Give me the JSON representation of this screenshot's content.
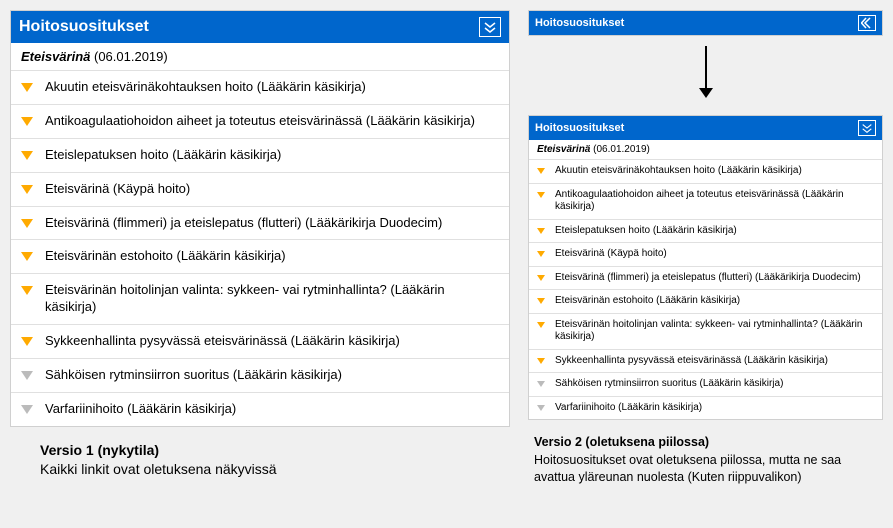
{
  "panel_title": "Hoitosuositukset",
  "topic": "Eteisvärinä",
  "date": "(06.01.2019)",
  "items": [
    {
      "label": "Akuutin eteisvärinäkohtauksen hoito (Lääkärin käsikirja)",
      "active": true
    },
    {
      "label": "Antikoagulaatiohoidon aiheet ja toteutus eteisvärinässä (Lääkärin käsikirja)",
      "active": true
    },
    {
      "label": "Eteislepatuksen hoito (Lääkärin käsikirja)",
      "active": true
    },
    {
      "label": "Eteisvärinä (Käypä hoito)",
      "active": true
    },
    {
      "label": "Eteisvärinä (flimmeri) ja eteislepatus (flutteri) (Lääkärikirja Duodecim)",
      "active": true
    },
    {
      "label": "Eteisvärinän estohoito (Lääkärin käsikirja)",
      "active": true
    },
    {
      "label": "Eteisvärinän hoitolinjan valinta: sykkeen- vai rytminhallinta? (Lääkärin käsikirja)",
      "active": true
    },
    {
      "label": "Sykkeenhallinta pysyvässä eteisvärinässä (Lääkärin käsikirja)",
      "active": true
    },
    {
      "label": "Sähköisen rytminsiirron suoritus (Lääkärin käsikirja)",
      "active": false
    },
    {
      "label": "Varfariinihoito (Lääkärin käsikirja)",
      "active": false
    }
  ],
  "caption1": {
    "title": "Versio 1 (nykytila)",
    "text": "Kaikki linkit ovat oletuksena näkyvissä"
  },
  "caption2": {
    "title": "Versio 2 (oletuksena piilossa)",
    "text": "Hoitosuositukset ovat oletuksena piilossa, mutta ne saa avattua yläreunan nuolesta (Kuten riippuvalikon)"
  }
}
